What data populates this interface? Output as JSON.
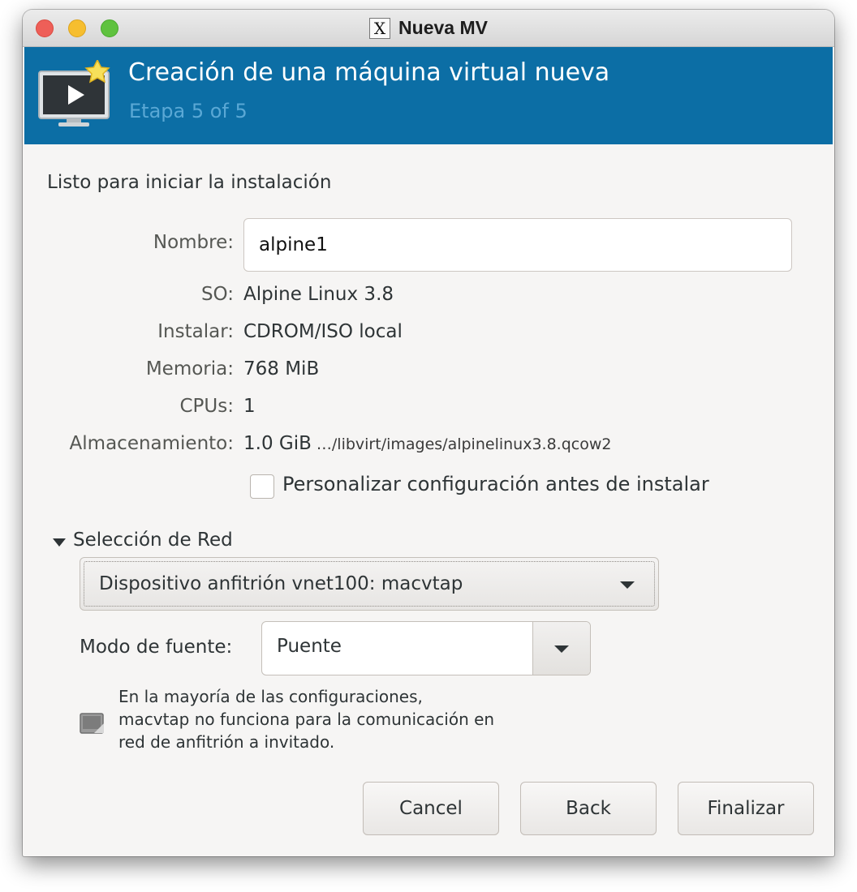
{
  "window": {
    "title": "Nueva MV",
    "title_icon": "x11-icon"
  },
  "header": {
    "title": "Creación de una máquina virtual nueva",
    "subtitle": "Etapa 5 of 5",
    "icon": "monitor-play-star-icon"
  },
  "summary": {
    "heading": "Listo para iniciar la instalación",
    "name_label": "Nombre:",
    "name_value": "alpine1",
    "os_label": "SO:",
    "os_value": "Alpine Linux 3.8",
    "install_label": "Instalar:",
    "install_value": "CDROM/ISO local",
    "memory_label": "Memoria:",
    "memory_value": "768 MiB",
    "cpus_label": "CPUs:",
    "cpus_value": "1",
    "storage_label": "Almacenamiento:",
    "storage_size": "1.0 GiB",
    "storage_path": "…/libvirt/images/alpinelinux3.8.qcow2",
    "customize_label": "Personalizar configuración antes de instalar",
    "customize_checked": false
  },
  "network": {
    "expander_label": "Selección de Red",
    "device_selected": "Dispositivo anfitrión vnet100: macvtap",
    "source_mode_label": "Modo de fuente:",
    "source_mode_selected": "Puente",
    "info_lines": [
      "En la mayoría de las configuraciones,",
      "macvtap no funciona para la comunicación en",
      "red de anfitrión a invitado."
    ]
  },
  "buttons": {
    "cancel": "Cancel",
    "back": "Back",
    "finish": "Finalizar"
  },
  "colors": {
    "header_bg": "#0c6ea5",
    "header_subtitle": "#5aa8d5",
    "window_bg": "#f6f5f4"
  }
}
